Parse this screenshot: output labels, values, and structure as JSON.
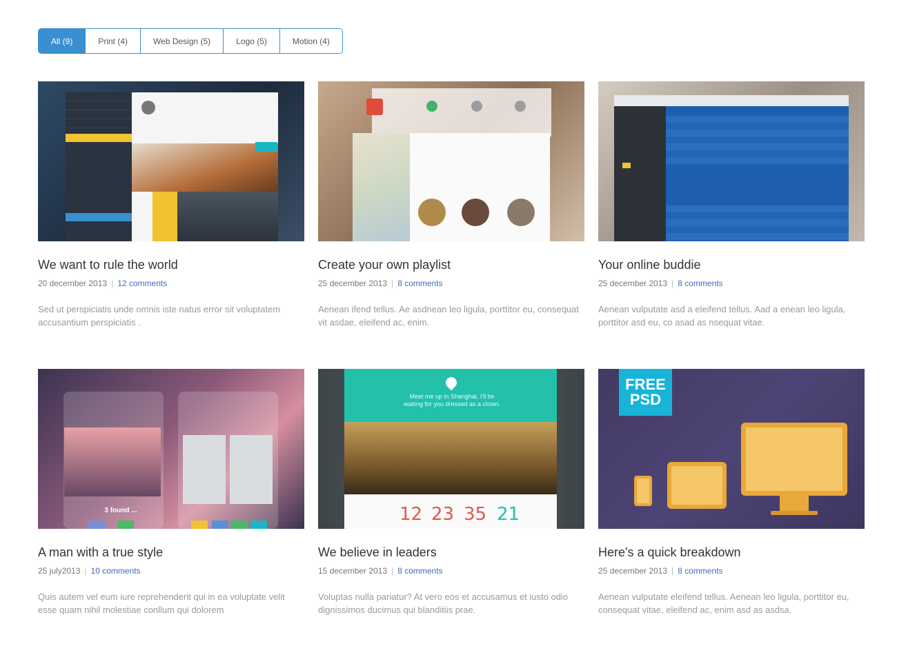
{
  "filters": [
    {
      "label": "All (9)"
    },
    {
      "label": "Print (4)"
    },
    {
      "label": "Web Design (5)"
    },
    {
      "label": "Logo (5)"
    },
    {
      "label": "Motion (4)"
    }
  ],
  "posts": [
    {
      "title": "We want to rule the world",
      "date": "20 december 2013",
      "comments": "12 comments",
      "excerpt": "Sed ut perspiciatis unde omnis iste natus error sit voluptatem accusantium perspiciatis ."
    },
    {
      "title": "Create your own playlist",
      "date": "25 december 2013",
      "comments": "8 comments",
      "excerpt": "Aenean ifend tellus. Ae asdnean leo ligula, porttitor eu, consequat vit asdae, eleifend ac, enim."
    },
    {
      "title": "Your online buddie",
      "date": "25 december 2013",
      "comments": "8 comments",
      "excerpt": "Aenean vulputate asd a eleifend tellus. Aad a enean leo ligula, porttitor asd eu, co asad as nsequat vitae."
    },
    {
      "title": "A man with a true style",
      "date": "25 july2013",
      "comments": "10 comments",
      "excerpt": "Quis autem vel eum iure reprehenderit qui in ea voluptate velit esse quam nihil molestiae conllum qui dolorem"
    },
    {
      "title": "We believe in leaders",
      "date": "15 december 2013",
      "comments": "8 comments",
      "excerpt": "Voluptas nulla pariatur? At vero eos et accusamus et iusto odio dignissimos ducimus qui blanditiis prae."
    },
    {
      "title": "Here's a quick breakdown",
      "date": "25 december 2013",
      "comments": "8 comments",
      "excerpt": "Aenean vulputate eleifend tellus. Aenean leo ligula, porttitor eu, consequat vitae, eleifend ac, enim asd as asdsa."
    }
  ],
  "thumbs": {
    "t4_found": "3 found ...",
    "t5_msg": "Meet me up in Shanghai, I'll be waiting for you dressed as a clown.",
    "t5_nums": [
      "12",
      "23",
      "35",
      "21"
    ],
    "t6_badge_line1": "FREE",
    "t6_badge_line2": "PSD"
  },
  "colors": {
    "accent": "#3a8fd0",
    "link": "#3b6fb5"
  }
}
